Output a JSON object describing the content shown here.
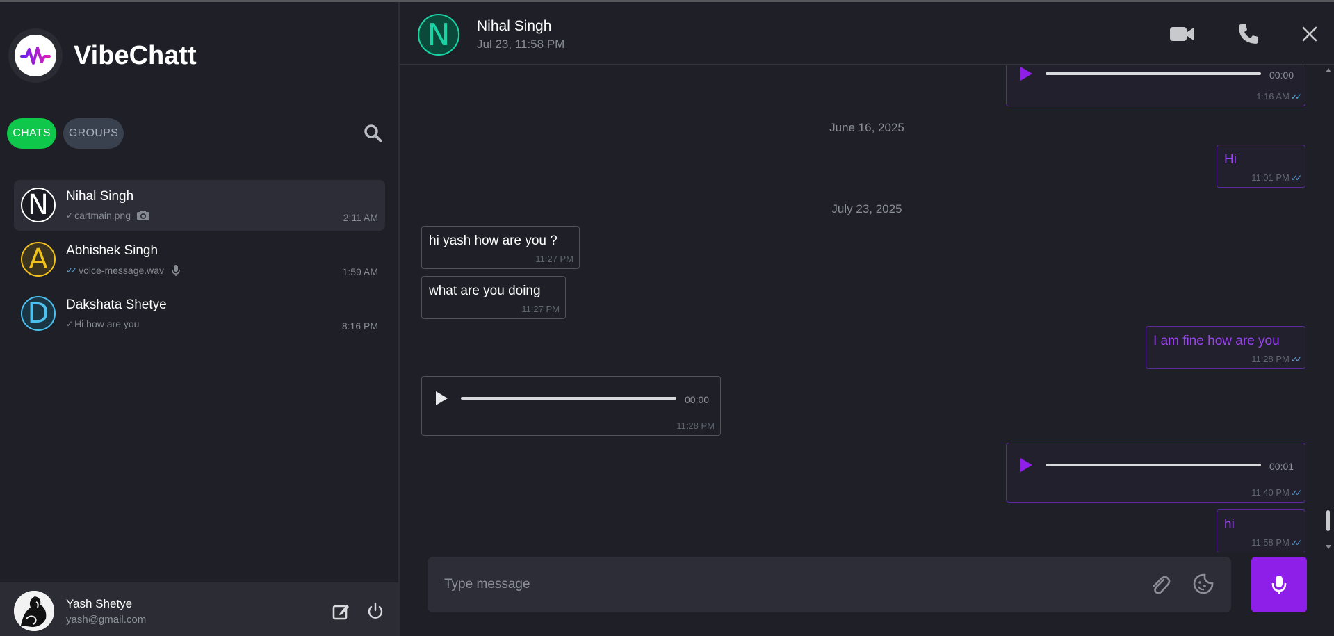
{
  "app": {
    "name": "VibeChatt"
  },
  "sidebar": {
    "tabs": [
      {
        "label": "CHATS",
        "active": true
      },
      {
        "label": "GROUPS",
        "active": false
      }
    ],
    "chats": [
      {
        "initial": "N",
        "name": "Nihal Singh",
        "preview": "cartmain.png",
        "preview_icon": "camera-icon",
        "ticks": "single",
        "time": "2:11 AM",
        "avatar_color": "#ffffff",
        "avatar_bg": "#1c1d24",
        "selected": true
      },
      {
        "initial": "A",
        "name": "Abhishek Singh",
        "preview": "voice-message.wav",
        "preview_icon": "mic-icon",
        "ticks": "double-blue",
        "time": "1:59 AM",
        "avatar_color": "#f2c21c",
        "avatar_bg": "#3a3320",
        "selected": false
      },
      {
        "initial": "D",
        "name": "Dakshata Shetye",
        "preview": "Hi how are you",
        "preview_icon": "",
        "ticks": "single",
        "time": "8:16 PM",
        "avatar_color": "#4dc0f0",
        "avatar_bg": "#1a3543",
        "selected": false
      }
    ],
    "profile": {
      "name": "Yash Shetye",
      "email": "yash@gmail.com"
    }
  },
  "header": {
    "initial": "N",
    "name": "Nihal Singh",
    "status": "Jul 23, 11:58 PM"
  },
  "messages": {
    "dates": [
      "June 16, 2025",
      "July 23, 2025"
    ],
    "items": [
      {
        "direction": "out",
        "type": "audio",
        "duration": "00:00",
        "time": "1:16 AM"
      },
      {
        "direction": "out",
        "type": "text",
        "text": "Hi",
        "time": "11:01 PM"
      },
      {
        "direction": "in",
        "type": "text",
        "text": "hi yash how are you ?",
        "time": "11:27 PM"
      },
      {
        "direction": "in",
        "type": "text",
        "text": "what are you doing",
        "time": "11:27 PM"
      },
      {
        "direction": "out",
        "type": "text",
        "text": "I am fine how are you",
        "time": "11:28 PM"
      },
      {
        "direction": "in",
        "type": "audio",
        "duration": "00:00",
        "time": "11:28 PM"
      },
      {
        "direction": "out",
        "type": "audio",
        "duration": "00:01",
        "time": "11:40 PM"
      },
      {
        "direction": "out",
        "type": "text",
        "text": "hi",
        "time": "11:58 PM"
      }
    ]
  },
  "composer": {
    "placeholder": "Type message"
  },
  "colors": {
    "accent_purple": "#8e1fe8",
    "accent_green": "#0fc74a",
    "read_tick": "#49a8e4",
    "contact_teal": "#17d4a4"
  }
}
